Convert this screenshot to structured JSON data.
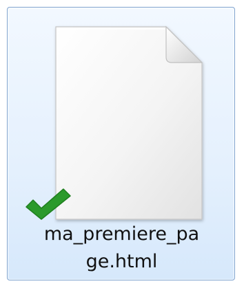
{
  "file": {
    "name": "ma_premiere_page.html",
    "name_line1": "ma_premiere_pa",
    "name_line2": "ge.html",
    "icon": "blank-document-icon",
    "status_icon": "checkmark-icon",
    "status_color": "#2b9a2b",
    "selection_border_color": "#7da2ce",
    "selection_fill_color": "#e4f0fd"
  }
}
